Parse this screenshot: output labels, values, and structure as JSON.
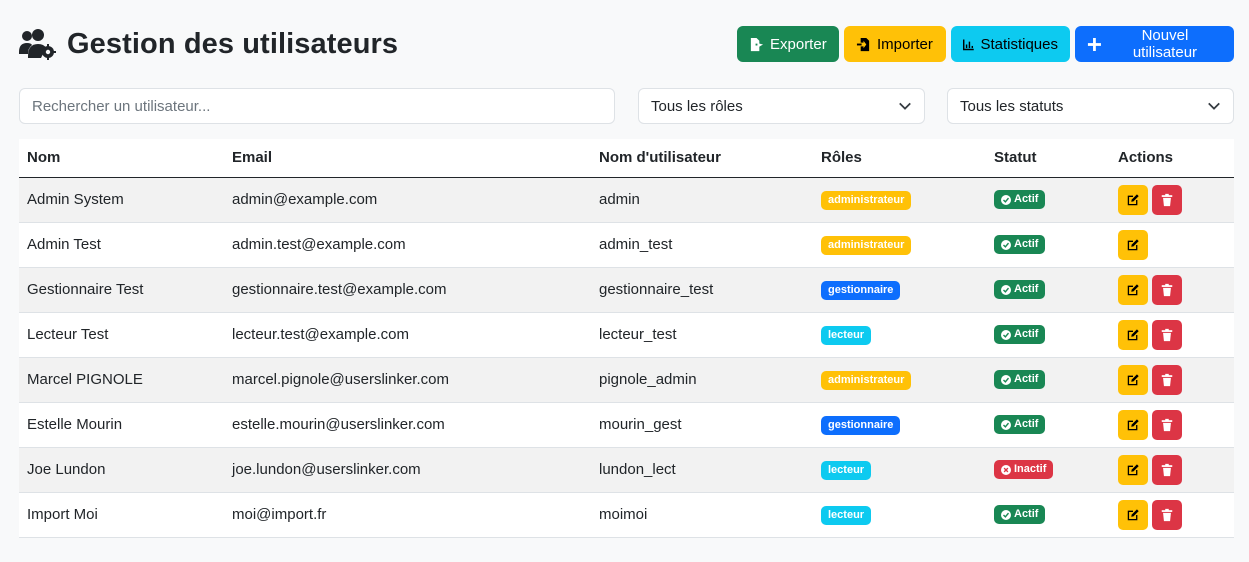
{
  "header": {
    "title": "Gestion des utilisateurs",
    "title_icon": "users-gear-icon"
  },
  "toolbar": {
    "export_label": "Exporter",
    "import_label": "Importer",
    "stats_label": "Statistiques",
    "new_user_label": "Nouvel utilisateur"
  },
  "filters": {
    "search_placeholder": "Rechercher un utilisateur...",
    "search_value": "",
    "roles_selected": "Tous les rôles",
    "status_selected": "Tous les statuts"
  },
  "table": {
    "columns": [
      "Nom",
      "Email",
      "Nom d'utilisateur",
      "Rôles",
      "Statut",
      "Actions"
    ],
    "rows": [
      {
        "nom": "Admin System",
        "email": "admin@example.com",
        "username": "admin",
        "role": "administrateur",
        "status": "Actif",
        "can_delete": true
      },
      {
        "nom": "Admin Test",
        "email": "admin.test@example.com",
        "username": "admin_test",
        "role": "administrateur",
        "status": "Actif",
        "can_delete": false
      },
      {
        "nom": "Gestionnaire Test",
        "email": "gestionnaire.test@example.com",
        "username": "gestionnaire_test",
        "role": "gestionnaire",
        "status": "Actif",
        "can_delete": true
      },
      {
        "nom": "Lecteur Test",
        "email": "lecteur.test@example.com",
        "username": "lecteur_test",
        "role": "lecteur",
        "status": "Actif",
        "can_delete": true
      },
      {
        "nom": "Marcel PIGNOLE",
        "email": "marcel.pignole@userslinker.com",
        "username": "pignole_admin",
        "role": "administrateur",
        "status": "Actif",
        "can_delete": true
      },
      {
        "nom": "Estelle Mourin",
        "email": "estelle.mourin@userslinker.com",
        "username": "mourin_gest",
        "role": "gestionnaire",
        "status": "Actif",
        "can_delete": true
      },
      {
        "nom": "Joe Lundon",
        "email": "joe.lundon@userslinker.com",
        "username": "lundon_lect",
        "role": "lecteur",
        "status": "Inactif",
        "can_delete": true
      },
      {
        "nom": "Import Moi",
        "email": "moi@import.fr",
        "username": "moimoi",
        "role": "lecteur",
        "status": "Actif",
        "can_delete": true
      }
    ]
  },
  "colors": {
    "success": "#198754",
    "warning": "#ffc107",
    "info": "#0dcaf0",
    "primary": "#0d6efd",
    "danger": "#dc3545"
  }
}
